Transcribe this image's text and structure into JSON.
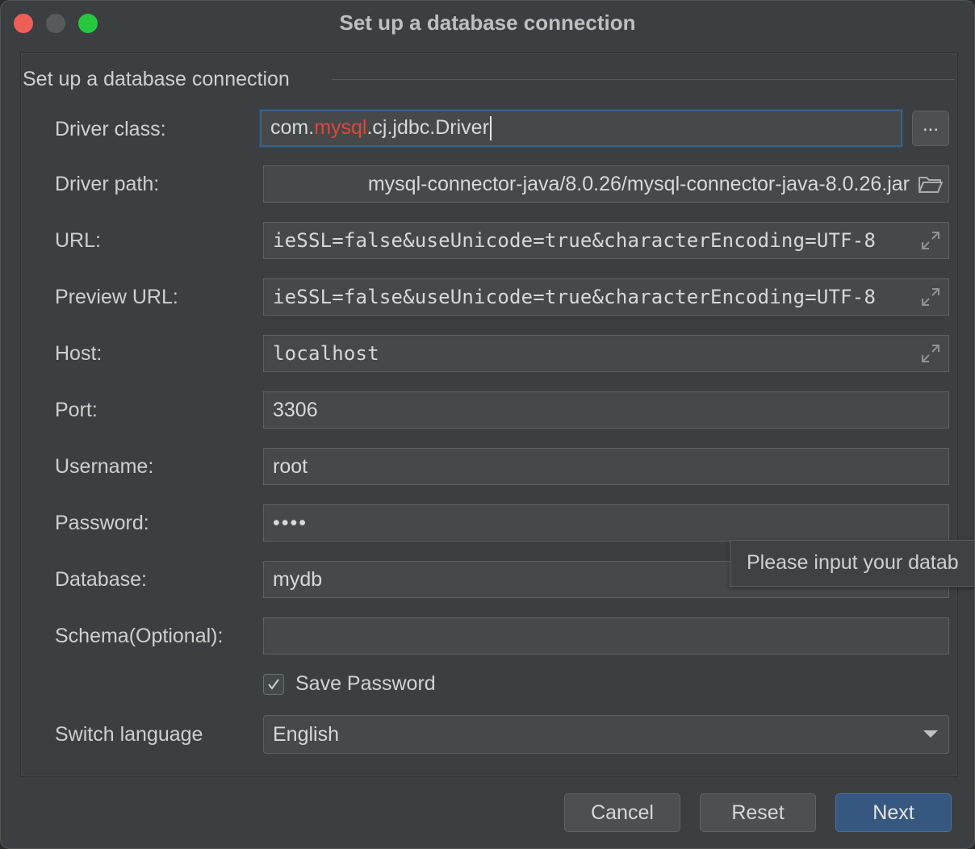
{
  "window": {
    "title": "Set up a database connection"
  },
  "group": {
    "title": "Set up a database connection"
  },
  "fields": {
    "driver_class": {
      "label": "Driver class:",
      "value_prefix": "com.",
      "value_highlight": "mysql",
      "value_suffix": ".cj.jdbc.Driver",
      "browse_label": "..."
    },
    "driver_path": {
      "label": "Driver path:",
      "value": "mysql-connector-java/8.0.26/mysql-connector-java-8.0.26.jar",
      "icon": "folder-icon"
    },
    "url": {
      "label": "URL:",
      "value": "ieSSL=false&useUnicode=true&characterEncoding=UTF-8",
      "icon": "expand-icon"
    },
    "preview_url": {
      "label": "Preview URL:",
      "value": "ieSSL=false&useUnicode=true&characterEncoding=UTF-8",
      "icon": "expand-icon"
    },
    "host": {
      "label": "Host:",
      "value": "localhost",
      "icon": "expand-icon"
    },
    "port": {
      "label": "Port:",
      "value": "3306"
    },
    "username": {
      "label": "Username:",
      "value": "root"
    },
    "password": {
      "label": "Password:",
      "value": "••••"
    },
    "database": {
      "label": "Database:",
      "value": "mydb"
    },
    "schema": {
      "label": "Schema(Optional):",
      "value": ""
    }
  },
  "save_password": {
    "label": "Save Password",
    "checked": true
  },
  "language": {
    "label": "Switch language",
    "selected": "English"
  },
  "tooltip": {
    "text": "Please input your datab"
  },
  "buttons": {
    "cancel": "Cancel",
    "reset": "Reset",
    "next": "Next"
  },
  "colors": {
    "accent": "#365880",
    "highlight_red": "#e0453d",
    "close": "#ee5f57",
    "maximize": "#27c840"
  }
}
